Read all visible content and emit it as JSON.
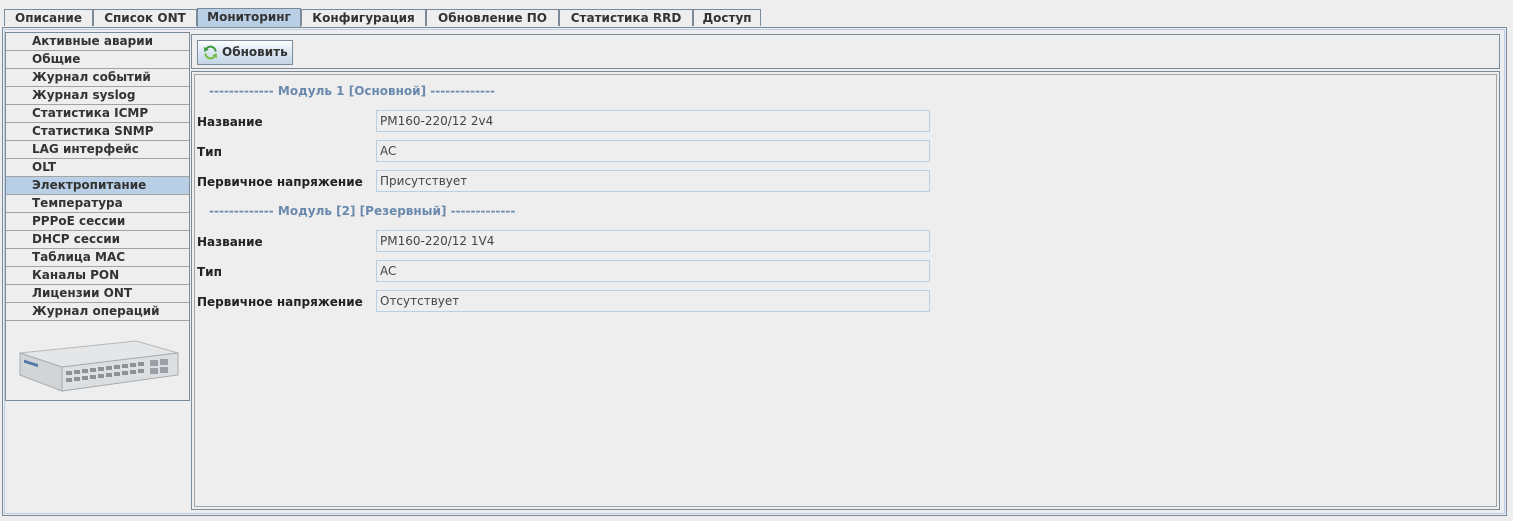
{
  "tabs": [
    {
      "label": "Описание",
      "active": false
    },
    {
      "label": "Список ONT",
      "active": false
    },
    {
      "label": "Мониторинг",
      "active": true
    },
    {
      "label": "Конфигурация",
      "active": false
    },
    {
      "label": "Обновление ПО",
      "active": false
    },
    {
      "label": "Статистика RRD",
      "active": false
    },
    {
      "label": "Доступ",
      "active": false
    }
  ],
  "sidebar": {
    "items": [
      {
        "label": "Активные аварии"
      },
      {
        "label": "Общие"
      },
      {
        "label": "Журнал событий"
      },
      {
        "label": "Журнал syslog"
      },
      {
        "label": "Статистика ICMP"
      },
      {
        "label": "Статистика SNMP"
      },
      {
        "label": "LAG интерфейс"
      },
      {
        "label": "OLT"
      },
      {
        "label": "Электропитание",
        "active": true
      },
      {
        "label": "Температура"
      },
      {
        "label": "PPPoE сессии"
      },
      {
        "label": "DHCP сессии"
      },
      {
        "label": "Таблица MAC"
      },
      {
        "label": "Каналы PON"
      },
      {
        "label": "Лицензии ONT"
      },
      {
        "label": "Журнал операций"
      }
    ],
    "device_image_icon": "olt-device-image"
  },
  "toolbar": {
    "refresh_label": "Обновить",
    "refresh_icon": "refresh-icon"
  },
  "modules": [
    {
      "title": "------------- Модуль 1 [Основной] -------------",
      "fields": [
        {
          "label": "Название",
          "value": "PM160-220/12 2v4"
        },
        {
          "label": "Тип",
          "value": "AC"
        },
        {
          "label": "Первичное напряжение",
          "value": "Присутствует"
        }
      ]
    },
    {
      "title": "------------- Модуль [2] [Резервный] -------------",
      "fields": [
        {
          "label": "Название",
          "value": "PM160-220/12 1V4"
        },
        {
          "label": "Тип",
          "value": "AC"
        },
        {
          "label": "Первичное напряжение",
          "value": "Отсутствует"
        }
      ]
    }
  ],
  "colors": {
    "accent": "#b8cfe5",
    "section_title": "#6a89ad",
    "border": "#7a8a99",
    "background": "#eeeeee"
  }
}
